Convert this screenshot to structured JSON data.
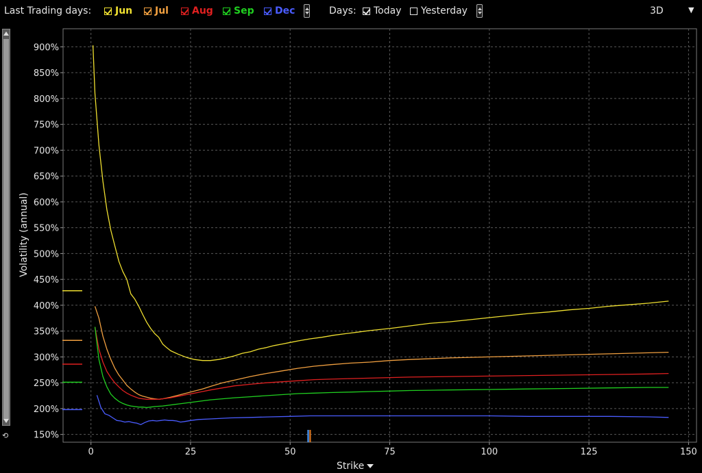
{
  "toolbar": {
    "last_trading_label": "Last Trading days:",
    "months": [
      {
        "label": "Jun",
        "color": "#f0e030",
        "checked": true
      },
      {
        "label": "Jul",
        "color": "#f2a040",
        "checked": true
      },
      {
        "label": "Aug",
        "color": "#e02020",
        "checked": true
      },
      {
        "label": "Sep",
        "color": "#20d020",
        "checked": true
      },
      {
        "label": "Dec",
        "color": "#4a5cff",
        "checked": true
      }
    ],
    "days_label": "Days:",
    "today_label": "Today",
    "today_checked": true,
    "yesterday_label": "Yesterday",
    "yesterday_checked": false,
    "view_mode": "3D"
  },
  "chart_data": {
    "type": "line",
    "title": "",
    "xlabel": "Strike",
    "ylabel": "Volatility (annual)",
    "xlim": [
      -7,
      152
    ],
    "ylim": [
      1.35,
      9.35
    ],
    "x_ticks": [
      0,
      25,
      50,
      75,
      100,
      125,
      150
    ],
    "x_tick_labels": [
      "0",
      "25",
      "50",
      "75",
      "100",
      "125",
      "150"
    ],
    "y_ticks": [
      1.5,
      2.0,
      2.5,
      3.0,
      3.5,
      4.0,
      4.5,
      5.0,
      5.5,
      6.0,
      6.5,
      7.0,
      7.5,
      8.0,
      8.5,
      9.0
    ],
    "y_tick_labels": [
      "150%",
      "200%",
      "250%",
      "300%",
      "350%",
      "400%",
      "450%",
      "500%",
      "550%",
      "600%",
      "650%",
      "700%",
      "750%",
      "800%",
      "850%",
      "900%"
    ],
    "grid": true,
    "series": [
      {
        "name": "Jun",
        "color": "#f0e030",
        "ref_level": 4.28,
        "x": [
          0.5,
          1,
          2,
          3,
          4,
          5,
          6,
          7,
          8,
          9,
          10,
          11,
          12,
          13,
          14,
          15,
          16,
          17,
          18,
          19,
          20,
          22,
          24,
          26,
          28,
          30,
          32,
          34,
          36,
          38,
          40,
          42,
          44,
          46,
          48,
          50,
          52,
          55,
          58,
          61,
          64,
          67,
          70,
          75,
          80,
          85,
          90,
          95,
          100,
          105,
          110,
          115,
          120,
          125,
          130,
          135,
          140,
          145
        ],
        "y": [
          9.03,
          8.1,
          7.1,
          6.4,
          5.85,
          5.45,
          5.15,
          4.85,
          4.65,
          4.5,
          4.22,
          4.12,
          3.98,
          3.82,
          3.67,
          3.55,
          3.45,
          3.38,
          3.25,
          3.18,
          3.12,
          3.05,
          2.99,
          2.95,
          2.93,
          2.93,
          2.95,
          2.98,
          3.02,
          3.07,
          3.1,
          3.15,
          3.18,
          3.22,
          3.25,
          3.28,
          3.31,
          3.35,
          3.38,
          3.42,
          3.45,
          3.48,
          3.51,
          3.55,
          3.6,
          3.65,
          3.68,
          3.72,
          3.76,
          3.8,
          3.84,
          3.87,
          3.91,
          3.94,
          3.98,
          4.01,
          4.04,
          4.08
        ]
      },
      {
        "name": "Jul",
        "color": "#f2a040",
        "ref_level": 3.32,
        "x": [
          1,
          2,
          3,
          4,
          5,
          6,
          7,
          8,
          9,
          10,
          11,
          12,
          13,
          14,
          15,
          16,
          17,
          18,
          20,
          22,
          24,
          26,
          28,
          30,
          33,
          36,
          40,
          44,
          48,
          52,
          56,
          60,
          65,
          70,
          75,
          80,
          90,
          100,
          110,
          120,
          130,
          140,
          145
        ],
        "y": [
          3.98,
          3.75,
          3.4,
          3.15,
          2.95,
          2.78,
          2.65,
          2.55,
          2.45,
          2.38,
          2.32,
          2.27,
          2.24,
          2.22,
          2.2,
          2.19,
          2.18,
          2.19,
          2.22,
          2.26,
          2.3,
          2.34,
          2.38,
          2.43,
          2.5,
          2.55,
          2.62,
          2.68,
          2.73,
          2.78,
          2.82,
          2.85,
          2.88,
          2.9,
          2.93,
          2.95,
          2.98,
          3.0,
          3.02,
          3.04,
          3.06,
          3.08,
          3.09
        ]
      },
      {
        "name": "Aug",
        "color": "#e02020",
        "ref_level": 2.86,
        "x": [
          1,
          2,
          3,
          4,
          5,
          6,
          7,
          8,
          9,
          10,
          11,
          12,
          13,
          14,
          15,
          16,
          17,
          18,
          20,
          22,
          24,
          26,
          28,
          30,
          33,
          36,
          40,
          44,
          48,
          52,
          56,
          60,
          65,
          70,
          75,
          80,
          90,
          100,
          110,
          120,
          130,
          140,
          145
        ],
        "y": [
          3.58,
          3.15,
          2.9,
          2.72,
          2.6,
          2.5,
          2.42,
          2.35,
          2.3,
          2.26,
          2.23,
          2.2,
          2.19,
          2.18,
          2.18,
          2.18,
          2.18,
          2.19,
          2.21,
          2.24,
          2.27,
          2.3,
          2.33,
          2.36,
          2.4,
          2.44,
          2.47,
          2.5,
          2.52,
          2.54,
          2.56,
          2.57,
          2.58,
          2.59,
          2.6,
          2.61,
          2.62,
          2.63,
          2.64,
          2.65,
          2.66,
          2.67,
          2.68
        ]
      },
      {
        "name": "Sep",
        "color": "#20d020",
        "ref_level": 2.51,
        "x": [
          1,
          2,
          3,
          4,
          5,
          6,
          7,
          8,
          9,
          10,
          11,
          12,
          13,
          14,
          15,
          16,
          18,
          20,
          22,
          24,
          26,
          28,
          30,
          33,
          36,
          40,
          44,
          48,
          52,
          56,
          60,
          65,
          70,
          75,
          80,
          90,
          100,
          110,
          120,
          130,
          140,
          145
        ],
        "y": [
          3.58,
          2.95,
          2.62,
          2.42,
          2.28,
          2.2,
          2.14,
          2.1,
          2.07,
          2.05,
          2.04,
          2.03,
          2.03,
          2.02,
          2.03,
          2.04,
          2.05,
          2.07,
          2.09,
          2.11,
          2.13,
          2.15,
          2.17,
          2.19,
          2.21,
          2.23,
          2.25,
          2.27,
          2.29,
          2.3,
          2.31,
          2.32,
          2.33,
          2.34,
          2.35,
          2.36,
          2.37,
          2.38,
          2.39,
          2.4,
          2.41,
          2.41
        ]
      },
      {
        "name": "Dec",
        "color": "#4a5cff",
        "ref_level": 1.98,
        "x": [
          1.5,
          2.5,
          3.5,
          4.5,
          5.5,
          6.5,
          7.5,
          8.5,
          9.5,
          10.5,
          11.5,
          12.5,
          13.5,
          14.5,
          15.5,
          16.5,
          17.5,
          18.5,
          19.5,
          20.5,
          21.5,
          22.5,
          23.5,
          25,
          27,
          30,
          35,
          40,
          45,
          50,
          55,
          60,
          65,
          70,
          80,
          90,
          100,
          110,
          120,
          130,
          140,
          145
        ],
        "y": [
          2.26,
          2.02,
          1.9,
          1.87,
          1.82,
          1.77,
          1.76,
          1.74,
          1.75,
          1.73,
          1.72,
          1.69,
          1.73,
          1.76,
          1.77,
          1.76,
          1.77,
          1.78,
          1.77,
          1.77,
          1.76,
          1.74,
          1.75,
          1.77,
          1.79,
          1.8,
          1.82,
          1.83,
          1.84,
          1.85,
          1.86,
          1.86,
          1.86,
          1.86,
          1.86,
          1.86,
          1.86,
          1.85,
          1.85,
          1.85,
          1.84,
          1.83
        ]
      }
    ],
    "markers": [
      {
        "x": 54.5,
        "color": "#4a9cff"
      },
      {
        "x": 55.0,
        "color": "#e07820"
      }
    ]
  }
}
